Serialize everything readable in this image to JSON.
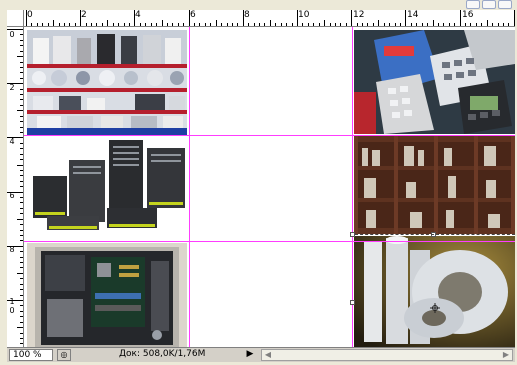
{
  "ruler": {
    "horizontal_labels": [
      "0",
      "2",
      "4",
      "6",
      "8",
      "10",
      "12",
      "14",
      "16"
    ],
    "vertical_labels": [
      "0",
      "2",
      "4",
      "6",
      "8",
      "1\n0"
    ]
  },
  "status": {
    "zoom": "100 %",
    "doc_info": "Док: 508,0K/1,76M"
  },
  "icons": {
    "status_nav": "circle-arrow-icon",
    "menu_arrow": "triangle-right-icon",
    "scroll_left": "scroll-left-icon",
    "scroll_right": "scroll-right-icon"
  },
  "colors": {
    "guide": "#ff3cff",
    "ruler_bg": "#ffffff",
    "status_bg": "#d4d0c8"
  }
}
